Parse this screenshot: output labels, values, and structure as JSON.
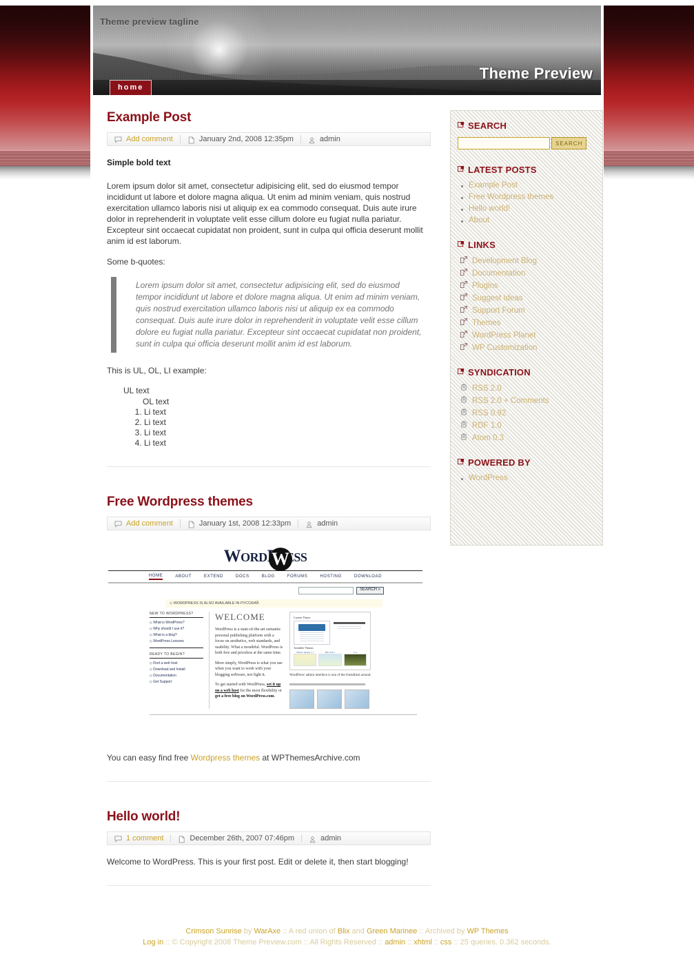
{
  "header": {
    "tagline": "Theme preview tagline",
    "blog_title": "Theme Preview",
    "nav": [
      {
        "label": "home",
        "name": "nav-item-home"
      }
    ]
  },
  "posts": [
    {
      "title": "Example Post",
      "comment_label": "Add comment",
      "date": "January 2nd, 2008 12:35pm",
      "author": "admin",
      "bold_line": "Simple bold text",
      "paragraph": "Lorem ipsum dolor sit amet, consectetur adipisicing elit, sed do eiusmod tempor incididunt ut labore et dolore magna aliqua. Ut enim ad minim veniam, quis nostrud exercitation ullamco laboris nisi ut aliquip ex ea commodo consequat. Duis aute irure dolor in reprehenderit in voluptate velit esse cillum dolore eu fugiat nulla pariatur. Excepteur sint occaecat cupidatat non proident, sunt in culpa qui officia deserunt mollit anim id est laborum.",
      "quote_intro": "Some b-quotes:",
      "blockquote": "Lorem ipsum dolor sit amet, consectetur adipisicing elit, sed do eiusmod tempor incididunt ut labore et dolore magna aliqua. Ut enim ad minim veniam, quis nostrud exercitation ullamco laboris nisi ut aliquip ex ea commodo consequat. Duis aute irure dolor in reprehenderit in voluptate velit esse cillum dolore eu fugiat nulla pariatur. Excepteur sint occaecat cupidatat non proident, sunt in culpa qui officia deserunt mollit anim id est laborum.",
      "list_intro": "This is UL, OL, LI example:",
      "ul_text": "UL text",
      "ol_head": "OL text",
      "ol_items": [
        "Li text",
        "Li text",
        "Li text",
        "Li text"
      ]
    },
    {
      "title": "Free Wordpress themes",
      "comment_label": "Add comment",
      "date": "January 1st, 2008 12:33pm",
      "author": "admin",
      "caption_before": "You can easy find free ",
      "caption_link": "Wordpress themes",
      "caption_after": " at WPThemesArchive.com"
    },
    {
      "title": "Hello world!",
      "comment_label": "1 comment",
      "date": "December 26th, 2007 07:46pm",
      "author": "admin",
      "paragraph": "Welcome to WordPress. This is your first post. Edit or delete it, then start blogging!"
    }
  ],
  "wp_screenshot": {
    "logo": "WordPress",
    "logo_mark": "W",
    "nav": [
      "HOME",
      "ABOUT",
      "EXTEND",
      "DOCS",
      "BLOG",
      "FORUMS",
      "HOSTING",
      "DOWNLOAD"
    ],
    "search_button": "SEARCH »",
    "notice": "◇ WORDPRESS IS ALSO AVAILABLE IN РУССКИЙ.",
    "left_head_1": "NEW TO WORDPRESS?",
    "left_links_1": [
      "◇ What is WordPress?",
      "◇ Why should I use it?",
      "◇ What is a blog?",
      "◇ WordPress Lessons"
    ],
    "left_head_2": "READY TO BEGIN?",
    "left_links_2": [
      "◇ Find a web host",
      "◇ Download and Install",
      "◇ Documentation",
      "◇ Get Support"
    ],
    "welcome": "WELCOME",
    "para_1": "WordPress is a state-of-the-art semantic personal publishing platform with a focus on aesthetics, web standards, and usability. What a mouthful. WordPress is both free and priceless at the same time.",
    "para_2": "More simply, WordPress is what you use when you want to work with your blogging software, not fight it.",
    "para_3_a": "To get started with WordPress, ",
    "para_3_b": "set it up on a web host",
    "para_3_c": " for the most flexibility or ",
    "para_3_d": "get a free blog on WordPress.com",
    "para_3_e": ".",
    "panel_title_1": "Current Theme",
    "panel_title_2": "Available Themes",
    "panel_note": "WordPress' admin interface is one of the friendliest around.",
    "theme_names": [
      "Winter Spring 1.1",
      "Blix 0.9.1",
      "Col"
    ]
  },
  "sidebar": {
    "widgets": [
      {
        "title": "SEARCH",
        "type": "search",
        "input_value": "",
        "input_placeholder": "",
        "button_label": "SEARCH"
      },
      {
        "title": "LATEST POSTS",
        "type": "bulleted",
        "items": [
          "Example Post",
          "Free Wordpress themes",
          "Hello world!",
          "About"
        ]
      },
      {
        "title": "LINKS",
        "type": "linkicon",
        "items": [
          "Development Blog",
          "Documentation",
          "Plugins",
          "Suggest Ideas",
          "Support Forum",
          "Themes",
          "WordPress Planet",
          "WP Customization"
        ]
      },
      {
        "title": "SYNDICATION",
        "type": "feed",
        "items": [
          "RSS 2.0",
          "RSS 2.0 + Comments",
          "RSS 0.92",
          "RDF 1.0",
          "Atom 0.3"
        ]
      },
      {
        "title": "POWERED BY",
        "type": "bulleted",
        "items": [
          "WordPress"
        ]
      }
    ]
  },
  "footer": {
    "line1": {
      "theme_name": "Crimson Sunrise",
      "by": " by ",
      "author": "WarAxe",
      "mid": " :: A red union of ",
      "credit1": "Blix",
      "and": " and ",
      "credit2": "Green Marinee",
      "mid2": " :: Archived by ",
      "credit3": "WP Themes"
    },
    "line2": {
      "login": "Log in",
      "copyright": " :: © Copyright 2008 Theme Preview.com :: All Rights Reserved :: ",
      "admin": "admin",
      "sep1": " :: ",
      "xhtml": "xhtml",
      "sep2": " :: ",
      "css": "css",
      "stats": " :: 25 queries. 0.362 seconds."
    }
  },
  "colors": {
    "accent_red": "#8b1119",
    "link_gold": "#c9a227",
    "sidebar_bg": "#f3f2ee"
  }
}
